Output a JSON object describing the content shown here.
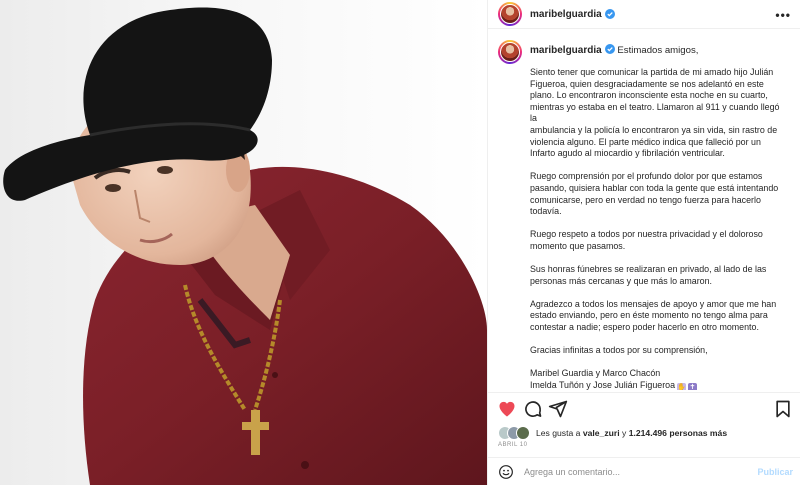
{
  "post": {
    "username": "maribelguardia",
    "verified": true
  },
  "caption": {
    "username": "maribelguardia",
    "greeting": "Estimados amigos,",
    "paragraphs": [
      [
        "Siento tener que comunicar la partida de mi amado hijo Julián",
        "Figueroa, quien desgraciadamente se nos adelantó en este",
        "plano. Lo encontraron inconsciente esta noche en su cuarto,",
        "mientras yo estaba en el teatro. Llamaron al 911 y cuando llegó",
        "la",
        "ambulancia y la policía lo encontraron ya sin vida, sin rastro de",
        "violencia alguno. El parte médico indica que falleció por un",
        "Infarto agudo al miocardio y fibrilación ventricular."
      ],
      [
        "Ruego comprensión por el profundo dolor por que estamos",
        "pasando, quisiera hablar con toda la gente que está intentando",
        "comunicarse, pero en verdad no tengo fuerza para hacerlo",
        "todavía."
      ],
      [
        "Ruego respeto a todos por nuestra privacidad y el doloroso",
        "momento que pasamos."
      ],
      [
        "Sus honras fúnebres se realizaran en privado, al lado de las",
        "personas más cercanas y que más lo amaron."
      ],
      [
        "Agradezco a todos los mensajes de apoyo y amor que me han",
        "estado enviando, pero en éste momento no tengo alma para",
        "contestar a nadie; espero poder hacerlo en otro momento."
      ],
      [
        "Gracias infinitas a todos por su comprensión,"
      ]
    ],
    "signature_line1": "Maribel Guardia y Marco Chacón",
    "signature_line2": "Imelda Tuñón y Jose Julián Figueroa"
  },
  "likes": {
    "prefix": "Les gusta a",
    "liker": "vale_zuri",
    "connector": "y",
    "count": "1.214.496 personas más"
  },
  "date": "ABRIL 10",
  "comment": {
    "placeholder": "Agrega un comentario...",
    "post_label": "Publicar"
  },
  "colors": {
    "liked_heart": "#ed4956",
    "verified_badge": "#3897f0",
    "post_button_disabled": "#b3dbff",
    "shirt": "#7a1f27"
  },
  "icons": [
    "heart-icon",
    "comment-icon",
    "share-icon",
    "save-icon",
    "emoji-icon",
    "more-options-icon",
    "verified-badge-icon"
  ]
}
